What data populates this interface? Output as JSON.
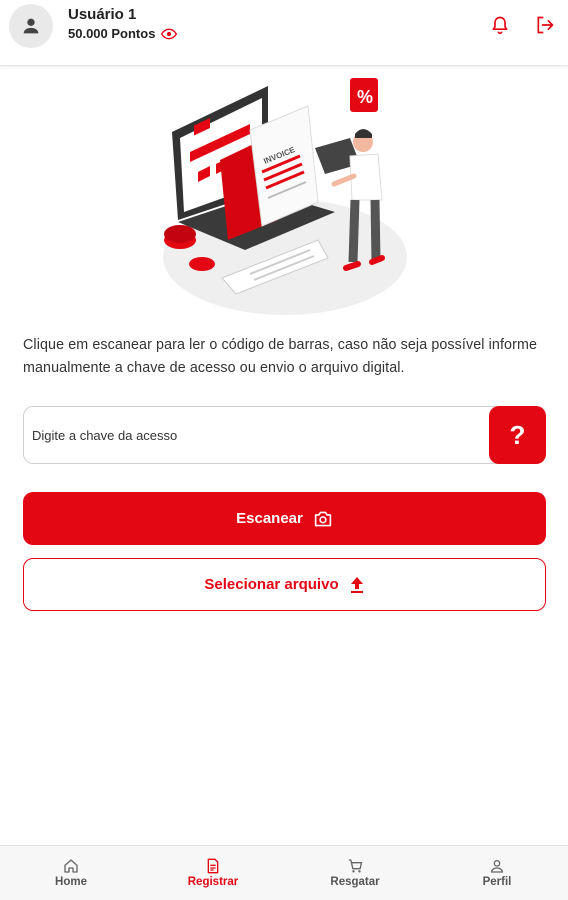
{
  "header": {
    "user_name": "Usuário 1",
    "points": "50.000 Pontos",
    "icons": [
      "user-icon",
      "eye-icon",
      "bell-icon",
      "logout-icon"
    ]
  },
  "main": {
    "instructions": "Clique em escanear para ler o código de barras, caso não seja possível informe manualmente a chave de acesso ou envio o arquivo digital.",
    "key_placeholder": "Digite a chave da acesso",
    "help_label": "?",
    "scan_label": "Escanear",
    "file_label": "Selecionar arquivo",
    "illustration_text": {
      "invoice": "INVOICE",
      "percent": "%"
    }
  },
  "nav": {
    "items": [
      {
        "label": "Home",
        "icon": "home-icon",
        "active": false
      },
      {
        "label": "Registrar",
        "icon": "receipt-icon",
        "active": true
      },
      {
        "label": "Resgatar",
        "icon": "cart-icon",
        "active": false
      },
      {
        "label": "Perfil",
        "icon": "person-icon",
        "active": false
      }
    ]
  },
  "colors": {
    "accent": "#e30613",
    "text": "#222222",
    "nav_bg": "#f7f7f7"
  }
}
